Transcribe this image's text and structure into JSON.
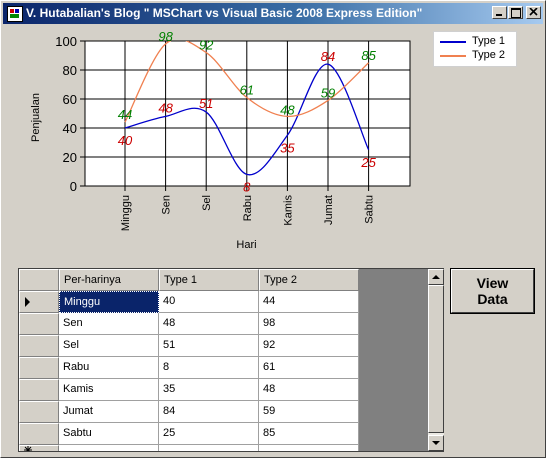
{
  "window": {
    "title": "V. Hutabalian's Blog \" MSChart vs Visual Basic 2008 Express Edition\""
  },
  "chart_data": {
    "type": "line",
    "categories": [
      "Minggu",
      "Sen",
      "Sel",
      "Rabu",
      "Kamis",
      "Jumat",
      "Sabtu"
    ],
    "series": [
      {
        "name": "Type 1",
        "values": [
          40,
          48,
          51,
          8,
          35,
          84,
          25
        ],
        "color": "#0000cc",
        "label_color": "#cc0000"
      },
      {
        "name": "Type 2",
        "values": [
          44,
          98,
          92,
          61,
          48,
          59,
          85
        ],
        "color": "#f08050",
        "label_color": "#008000"
      }
    ],
    "xlabel": "Hari",
    "ylabel": "Penjualan",
    "ylim": [
      0,
      100
    ],
    "yticks": [
      0,
      20,
      40,
      60,
      80,
      100
    ],
    "grid": true,
    "smooth": true,
    "legend_position": "top-right"
  },
  "grid": {
    "columns": [
      "Per-harinya",
      "Type 1",
      "Type 2"
    ],
    "rows": [
      [
        "Minggu",
        "40",
        "44"
      ],
      [
        "Sen",
        "48",
        "98"
      ],
      [
        "Sel",
        "51",
        "92"
      ],
      [
        "Rabu",
        "8",
        "61"
      ],
      [
        "Kamis",
        "35",
        "48"
      ],
      [
        "Jumat",
        "84",
        "59"
      ],
      [
        "Sabtu",
        "25",
        "85"
      ]
    ],
    "selected_row": 0
  },
  "button": {
    "line1": "View",
    "line2": "Data"
  },
  "icons": {
    "app": "app-icon",
    "minimize": "minimize-icon",
    "maximize": "maximize-icon",
    "close": "close-icon",
    "row_pointer": "row-pointer-icon",
    "new_row": "new-row-icon",
    "scroll_up": "scroll-up-arrow-icon",
    "scroll_down": "scroll-down-arrow-icon"
  }
}
